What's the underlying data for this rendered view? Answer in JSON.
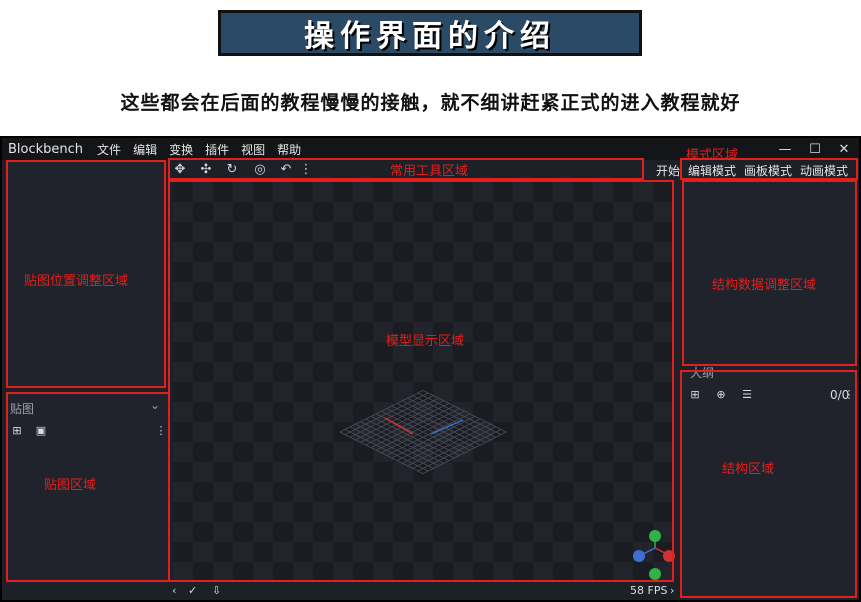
{
  "banner": {
    "title": "操作界面的介绍"
  },
  "subtitle": "这些都会在后面的教程慢慢的接触，就不细讲赶紧正式的进入教程就好",
  "app": {
    "brand": "Blockbench",
    "menus": [
      "文件",
      "编辑",
      "变换",
      "插件",
      "视图",
      "帮助"
    ],
    "window_controls": {
      "minimize": "—",
      "maximize": "☐",
      "close": "✕"
    }
  },
  "modes": {
    "start": "开始",
    "edit": "编辑模式",
    "paint": "画板模式",
    "animate": "动画模式"
  },
  "panels": {
    "textures_title": "贴图",
    "outliner_title": "大纲",
    "outliner_count": "0/0"
  },
  "status": {
    "fps": "58 FPS"
  },
  "annotations": {
    "mode_area": "模式区域",
    "tools_area": "常用工具区域",
    "uv_area": "贴图位置调整区域",
    "viewport_area": "模型显示区域",
    "textures_area": "贴图区域",
    "element_area": "结构数据调整区域",
    "outliner_area": "结构区域"
  },
  "colors": {
    "annotation_red": "#e0201c",
    "banner_bg": "#2a4a66",
    "app_bg": "#1e2028"
  }
}
